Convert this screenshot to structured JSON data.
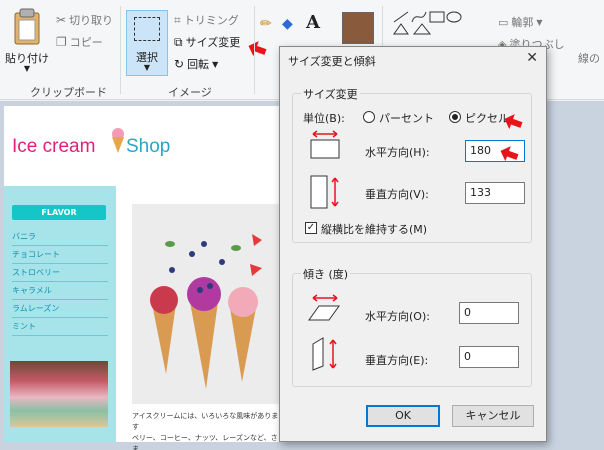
{
  "ribbon": {
    "paste_label": "貼り付け",
    "cut_label": "切り取り",
    "copy_label": "コピー",
    "clipboard_group": "クリップボード",
    "select_label": "選択",
    "crop_label": "トリミング",
    "resize_label": "サイズ変更",
    "rotate_label": "回転",
    "image_group": "イメージ",
    "outline_label": "輪郭",
    "fill_label": "塗りつぶし",
    "size_label": "線の",
    "text_tool_glyph": "A"
  },
  "page": {
    "logo_text": "Ice cream",
    "logo_shop": "Shop",
    "flavor_button": "FLAVOR",
    "menu_items": [
      "バニラ",
      "チョコレート",
      "ストロベリー",
      "キャラメル",
      "ラムレーズン",
      "ミント"
    ],
    "body_text_line1": "アイスクリームには、いろいろな風味があります",
    "body_text_line2": "ベリー、コーヒー、ナッツ、レーズンなど、さま"
  },
  "dialog": {
    "title": "サイズ変更と傾斜",
    "close_glyph": "✕",
    "resize_section": "サイズ変更",
    "unit_label": "単位(B):",
    "percent_label": "パーセント",
    "pixel_label": "ピクセル",
    "unit_selected": "pixel",
    "h_label": "水平方向(H):",
    "h_value": "180",
    "v_label": "垂直方向(V):",
    "v_value": "133",
    "keep_ratio_label": "縦横比を維持する(M)",
    "keep_ratio_checked": "✓",
    "skew_section": "傾き (度)",
    "skew_h_label": "水平方向(O):",
    "skew_h_value": "0",
    "skew_v_label": "垂直方向(E):",
    "skew_v_value": "0",
    "ok_label": "OK",
    "cancel_label": "キャンセル"
  },
  "colors": {
    "accent": "#0078d7",
    "arrow_red": "#e8141b",
    "logo_pink": "#e0207c",
    "logo_blue": "#2aa6c7",
    "sidebar_bg": "#a7e4ea"
  }
}
